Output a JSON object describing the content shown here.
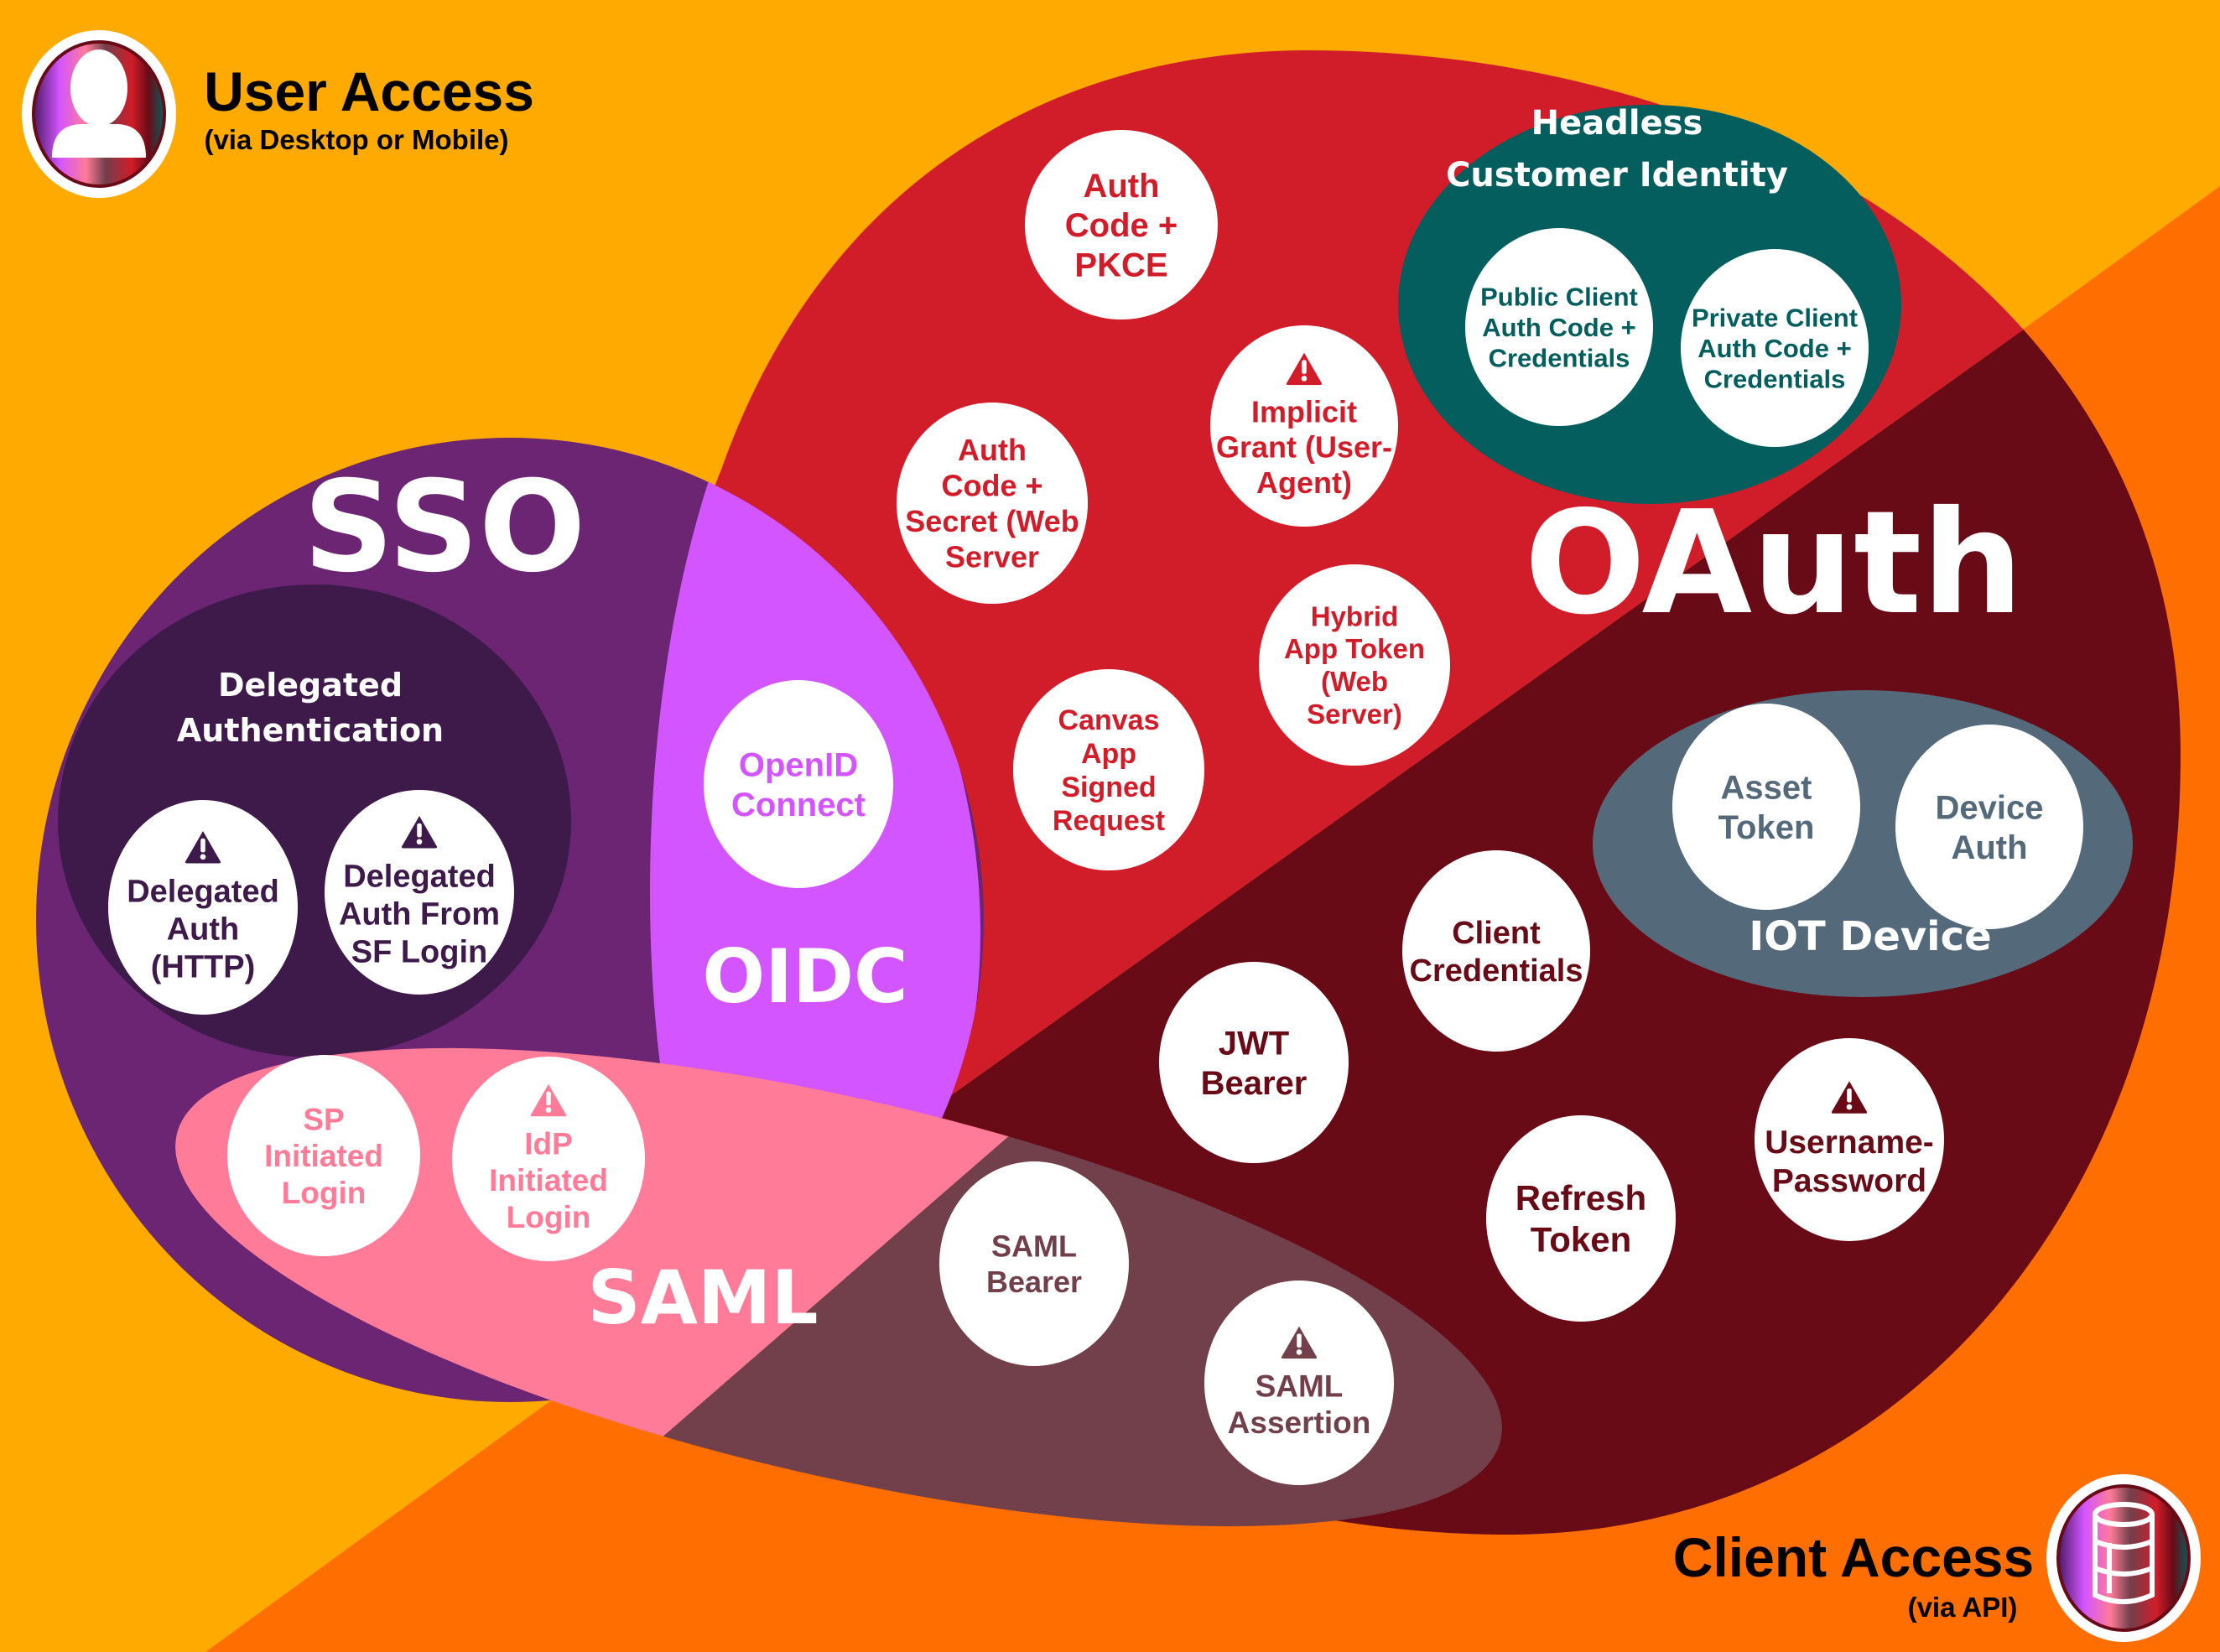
{
  "colors": {
    "bg_user": "#FFAA00",
    "bg_client": "#FF6E00",
    "sso": "#6B2573",
    "delegated": "#3D1A4A",
    "oidc": "#D355FF",
    "oauth_user": "#D11C29",
    "oauth_client": "#680B17",
    "saml_user": "#FF7B97",
    "saml_client": "#71404B",
    "headless": "#045E5E",
    "iot": "#546A7A",
    "white": "#FFFFFF"
  },
  "corners": {
    "user": {
      "title": "User Access",
      "subtitle": "(via Desktop or Mobile)",
      "icon": "user-icon"
    },
    "client": {
      "title": "Client Access",
      "subtitle": "(via API)",
      "icon": "database-icon"
    }
  },
  "regions": {
    "sso": "SSO",
    "oidc": "OIDC",
    "oauth": "OAuth",
    "saml": "SAML",
    "delegated": [
      "Delegated",
      "Authentication"
    ],
    "headless": [
      "Headless",
      "Customer Identity"
    ],
    "iot": "IOT Device"
  },
  "flows": {
    "delegated_http": {
      "lines": [
        "Delegated",
        "Auth",
        "(HTTP)"
      ],
      "warning": true
    },
    "delegated_sf": {
      "lines": [
        "Delegated",
        "Auth From",
        "SF Login"
      ],
      "warning": true
    },
    "openid": {
      "lines": [
        "OpenID",
        "Connect"
      ],
      "warning": false
    },
    "sp_login": {
      "lines": [
        "SP",
        "Initiated",
        "Login"
      ],
      "warning": false
    },
    "idp_login": {
      "lines": [
        "IdP",
        "Initiated",
        "Login"
      ],
      "warning": true
    },
    "auth_pkce": {
      "lines": [
        "Auth",
        "Code +",
        "PKCE"
      ],
      "warning": false
    },
    "implicit": {
      "lines": [
        "Implicit",
        "Grant (User-",
        "Agent)"
      ],
      "warning": true
    },
    "auth_secret": {
      "lines": [
        "Auth",
        "Code +",
        "Secret (Web",
        "Server"
      ],
      "warning": false
    },
    "hybrid": {
      "lines": [
        "Hybrid",
        "App Token",
        "(Web",
        "Server)"
      ],
      "warning": false
    },
    "canvas": {
      "lines": [
        "Canvas",
        "App",
        "Signed",
        "Request"
      ],
      "warning": false
    },
    "public_client": {
      "lines": [
        "Public Client",
        "Auth Code +",
        "Credentials"
      ],
      "warning": false
    },
    "private_client": {
      "lines": [
        "Private Client",
        "Auth Code +",
        "Credentials"
      ],
      "warning": false
    },
    "asset_token": {
      "lines": [
        "Asset",
        "Token"
      ],
      "warning": false
    },
    "device_auth": {
      "lines": [
        "Device",
        "Auth"
      ],
      "warning": false
    },
    "client_credentials": {
      "lines": [
        "Client",
        "Credentials"
      ],
      "warning": false
    },
    "jwt_bearer": {
      "lines": [
        "JWT",
        "Bearer"
      ],
      "warning": false
    },
    "refresh_token": {
      "lines": [
        "Refresh",
        "Token"
      ],
      "warning": false
    },
    "username_password": {
      "lines": [
        "Username-",
        "Password"
      ],
      "warning": true
    },
    "saml_bearer": {
      "lines": [
        "SAML",
        "Bearer"
      ],
      "warning": false
    },
    "saml_assertion": {
      "lines": [
        "SAML",
        "Assertion"
      ],
      "warning": true
    }
  }
}
